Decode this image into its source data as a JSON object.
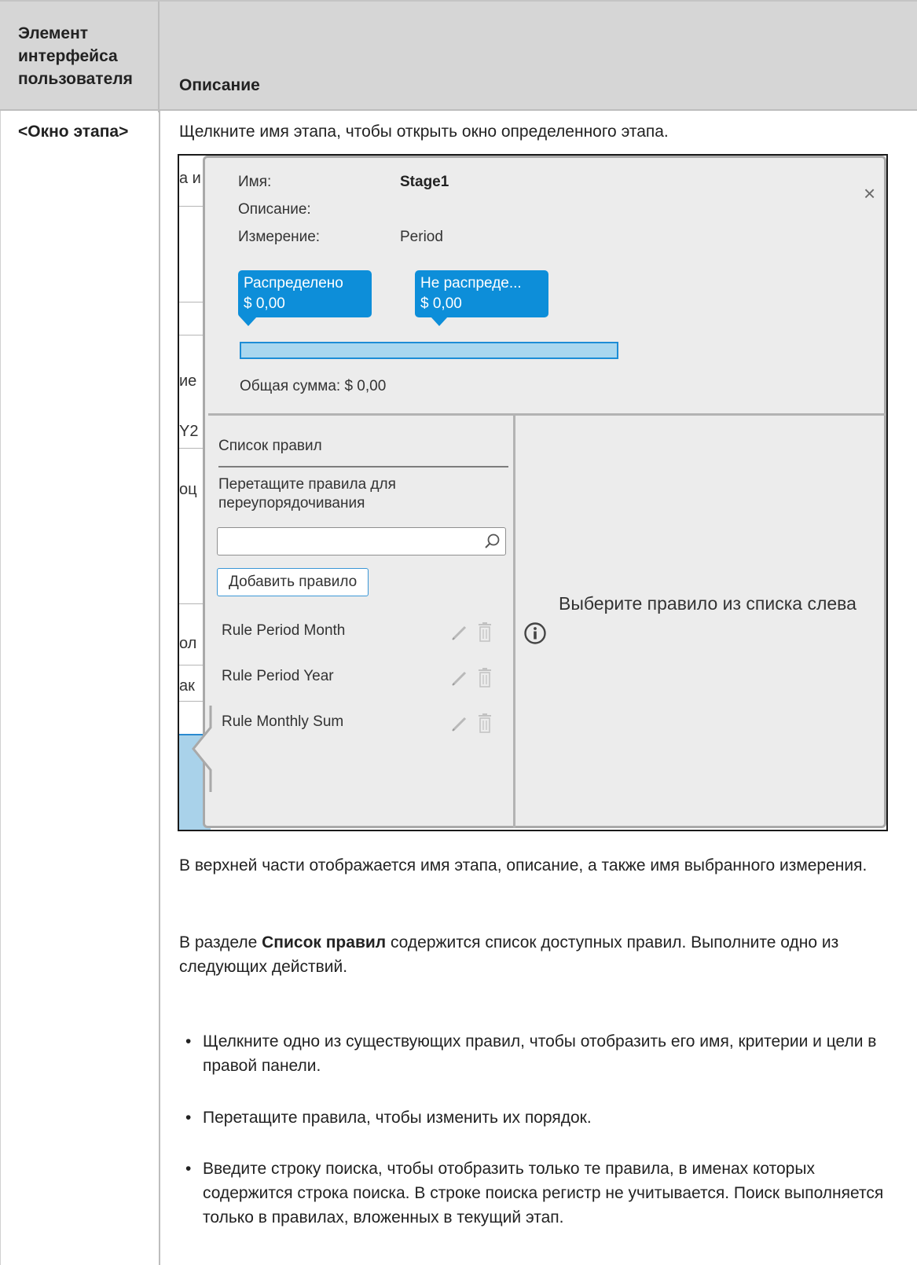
{
  "header": {
    "col1": "Элемент интерфейса пользователя",
    "col2": "Описание"
  },
  "row": {
    "label": "<Окно этапа>",
    "intro": "Щелкните имя этапа, чтобы открыть окно определенного этапа."
  },
  "background": {
    "fragments": [
      "а и",
      "ие",
      "Y2",
      "оц",
      "ол",
      "ак"
    ]
  },
  "stage_window": {
    "name_label": "Имя:",
    "name_value": "Stage1",
    "description_label": "Описание:",
    "dimension_label": "Измерение:",
    "dimension_value": "Period",
    "close_symbol": "×",
    "allocated_label": "Распределено",
    "allocated_value": "$ 0,00",
    "unallocated_label": "Не распреде...",
    "unallocated_value": "$ 0,00",
    "allocated_fraction": 0,
    "total_text": "Общая сумма: $ 0,00",
    "rule_list_title": "Список правил",
    "rule_list_hint": "Перетащите правила для переупорядочивания",
    "search_placeholder": "",
    "add_rule_label": "Добавить правило",
    "rules": [
      {
        "name": "Rule Period Month"
      },
      {
        "name": "Rule Period Year"
      },
      {
        "name": "Rule Monthly Sum"
      }
    ],
    "select_message": "Выберите правило из списка слева",
    "colors": {
      "accent": "#0d8ed9",
      "bar_fill": "#a9d7ef",
      "panel": "#ececec"
    }
  },
  "text": {
    "p1": "В верхней части отображается имя этапа, описание, а также имя выбранного измерения.",
    "p2_prefix": "В разделе ",
    "p2_bold": "Список правил",
    "p2_suffix": " содержится список доступных правил. Выполните одно из следующих действий.",
    "bullets": [
      "Щелкните одно из существующих правил, чтобы отобразить его имя, критерии и цели в правой панели.",
      "Перетащите правила, чтобы изменить их порядок.",
      "Введите строку поиска, чтобы отобразить только те правила, в именах которых содержится строка поиска. В строке поиска регистр не учитывается. Поиск выполняется только в правилах, вложенных в текущий этап."
    ]
  }
}
